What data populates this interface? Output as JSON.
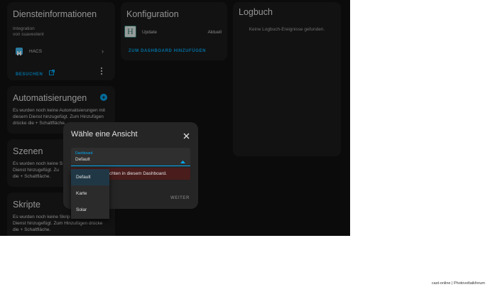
{
  "service_card": {
    "title": "Diensteinformationen",
    "line1": "Integration",
    "line2": "von suaveolent",
    "item_label": "HACS",
    "visit_label": "BESUCHEN"
  },
  "config_card": {
    "title": "Konfiguration",
    "row_label": "Update",
    "row_value": "Aktuell",
    "add_label": "ZUM DASHBOARD HINZUFÜGEN"
  },
  "log_card": {
    "title": "Logbuch",
    "empty_text": "Keine Logbuch-Ereignisse gefunden."
  },
  "automations_card": {
    "title": "Automatisierungen",
    "text": "Es wurden noch keine Automatisierungen mit diesem Dienst hinzugefügt. Zum Hinzufügen drücke die + Schaltfläche."
  },
  "scenes_card": {
    "title": "Szenen",
    "text": "Es wurden noch keine S... Dienst hinzugefügt. Zum Hinzufügen drücke die + Schaltfläche.",
    "line1": "Es wurden noch keine S",
    "line2": "Dienst hinzugefügt. Zu",
    "line3": "die + Schaltfläche."
  },
  "scripts_card": {
    "title": "Skripte",
    "line1": "Es wurden noch keine Skrip",
    "line2": "Dienst hinzugefügt. Zum Hinzufügen drücke",
    "line3": "die + Schaltfläche."
  },
  "dialog": {
    "title": "Wähle eine Ansicht",
    "select_label": "Dashboard",
    "select_value": "Default",
    "error_text": "chten in diesem Dashboard.",
    "next_label": "WEITER"
  },
  "dropdown": {
    "options": [
      "Default",
      "Karte",
      "Solar"
    ],
    "selected": "Default"
  },
  "footer": {
    "text": "cast-online | Photovoltaikforum"
  },
  "colors": {
    "accent": "#03a9f4",
    "background": "#111111",
    "card": "#1c1c1c",
    "error_bg": "#4a1c1c"
  }
}
